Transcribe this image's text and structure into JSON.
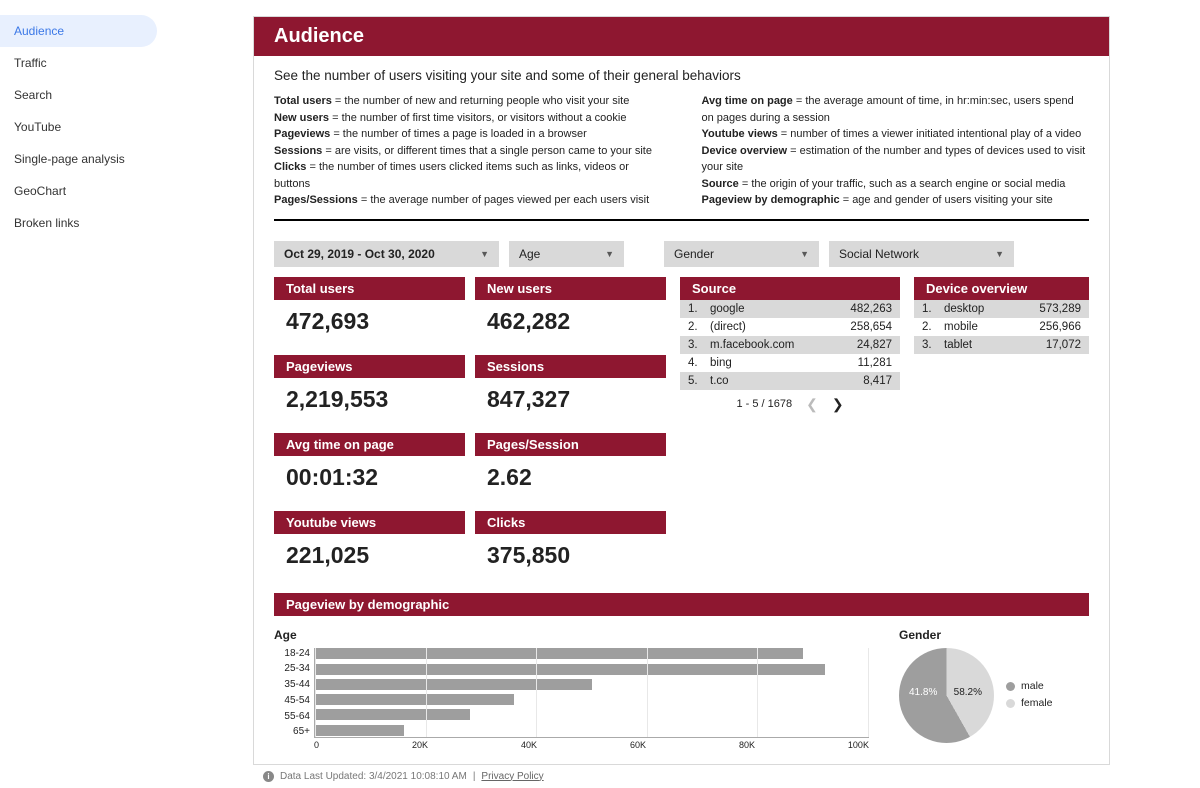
{
  "sidebar": {
    "items": [
      {
        "label": "Audience",
        "active": true
      },
      {
        "label": "Traffic"
      },
      {
        "label": "Search"
      },
      {
        "label": "YouTube"
      },
      {
        "label": "Single-page analysis"
      },
      {
        "label": "GeoChart"
      },
      {
        "label": "Broken links"
      }
    ]
  },
  "header": {
    "title": "Audience",
    "intro": "See the number of users visiting your site and some of their general behaviors",
    "defs_left": [
      {
        "term": "Total users",
        "desc": " = the number of new and returning people who visit your site"
      },
      {
        "term": "New users",
        "desc": " = the number of first time visitors, or visitors without a cookie"
      },
      {
        "term": "Pageviews",
        "desc": " = the number of times a page is loaded in a browser"
      },
      {
        "term": "Sessions",
        "desc": " = are visits, or different times that a single person came to your site"
      },
      {
        "term": "Clicks",
        "desc": " = the number of times users clicked items such as links, videos or buttons"
      },
      {
        "term": "Pages/Sessions",
        "desc": " = the average number of pages viewed per each users visit"
      }
    ],
    "defs_right": [
      {
        "term": "Avg time on page",
        "desc": " = the average amount of time, in hr:min:sec, users spend on pages during a session"
      },
      {
        "term": "Youtube views",
        "desc": " = number of times a viewer initiated intentional play of a video"
      },
      {
        "term": "Device overview",
        "desc": " = estimation of the number and types of devices used to visit your site"
      },
      {
        "term": "Source",
        "desc": " = the origin of your traffic, such as a search engine or social media"
      },
      {
        "term": "Pageview by demographic",
        "desc": " = age and gender of users visiting your site"
      }
    ]
  },
  "filters": {
    "date": "Oct 29, 2019 - Oct 30, 2020",
    "age": "Age",
    "gender": "Gender",
    "social": "Social Network"
  },
  "metrics": {
    "total_users": {
      "label": "Total users",
      "value": "472,693"
    },
    "new_users": {
      "label": "New users",
      "value": "462,282"
    },
    "pageviews": {
      "label": "Pageviews",
      "value": "2,219,553"
    },
    "sessions": {
      "label": "Sessions",
      "value": "847,327"
    },
    "avg_time": {
      "label": "Avg time on page",
      "value": "00:01:32"
    },
    "pages_session": {
      "label": "Pages/Session",
      "value": "2.62"
    },
    "youtube": {
      "label": "Youtube views",
      "value": "221,025"
    },
    "clicks": {
      "label": "Clicks",
      "value": "375,850"
    }
  },
  "source": {
    "head": "Source",
    "rows": [
      {
        "idx": "1.",
        "name": "google",
        "val": "482,263"
      },
      {
        "idx": "2.",
        "name": "(direct)",
        "val": "258,654"
      },
      {
        "idx": "3.",
        "name": "m.facebook.com",
        "val": "24,827"
      },
      {
        "idx": "4.",
        "name": "bing",
        "val": "11,281"
      },
      {
        "idx": "5.",
        "name": "t.co",
        "val": "8,417"
      }
    ],
    "pager": "1 - 5 / 1678"
  },
  "device": {
    "head": "Device overview",
    "rows": [
      {
        "idx": "1.",
        "name": "desktop",
        "val": "573,289"
      },
      {
        "idx": "2.",
        "name": "mobile",
        "val": "256,966"
      },
      {
        "idx": "3.",
        "name": "tablet",
        "val": "17,072"
      }
    ]
  },
  "demo": {
    "head": "Pageview by demographic",
    "age_label": "Age",
    "gender_label": "Gender",
    "gender_legend": [
      "male",
      "female"
    ],
    "gender_values": {
      "male": "58.2%",
      "female": "41.8%"
    }
  },
  "chart_data": [
    {
      "type": "bar",
      "orientation": "horizontal",
      "title": "Age",
      "ylabel": "",
      "xlabel": "",
      "xlim": [
        0,
        100000
      ],
      "categories": [
        "18-24",
        "25-34",
        "35-44",
        "45-54",
        "55-64",
        "65+"
      ],
      "values": [
        88000,
        92000,
        50000,
        36000,
        28000,
        16000
      ],
      "ticks": [
        "0",
        "20K",
        "40K",
        "60K",
        "80K",
        "100K"
      ]
    },
    {
      "type": "pie",
      "title": "Gender",
      "series": [
        {
          "name": "male",
          "value": 58.2,
          "color": "#9e9e9e"
        },
        {
          "name": "female",
          "value": 41.8,
          "color": "#d9d9d9"
        }
      ]
    }
  ],
  "footer": {
    "updated": "Data Last Updated: 3/4/2021 10:08:10 AM",
    "sep": "|",
    "privacy": "Privacy Policy"
  }
}
